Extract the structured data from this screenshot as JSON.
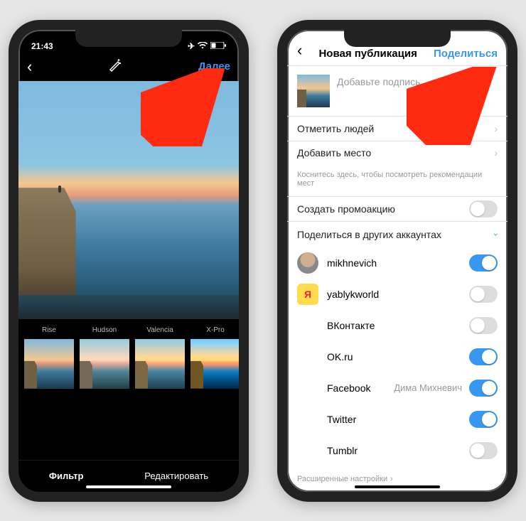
{
  "phone1": {
    "status": {
      "time": "21:43",
      "icons": [
        "airplane",
        "wifi",
        "battery"
      ]
    },
    "nav": {
      "next": "Далее"
    },
    "filters": [
      {
        "name": "Rise",
        "id": "rise"
      },
      {
        "name": "Hudson",
        "id": "hudson"
      },
      {
        "name": "Valencia",
        "id": "valencia"
      },
      {
        "name": "X-Pro",
        "id": "xpro"
      }
    ],
    "tabs": {
      "filter": "Фильтр",
      "edit": "Редактировать"
    }
  },
  "phone2": {
    "nav": {
      "title": "Новая публикация",
      "share": "Поделиться"
    },
    "caption_placeholder": "Добавьте подпись...",
    "rows": {
      "tag_people": "Отметить людей",
      "add_location": "Добавить место",
      "location_hint": "Коснитесь здесь, чтобы посмотреть рекомендации мест",
      "create_promo": "Создать промоакцию",
      "share_other": "Поделиться в других аккаунтах"
    },
    "accounts": [
      {
        "name": "mikhnevich",
        "avatar": "user",
        "on": true
      },
      {
        "name": "yablykworld",
        "avatar": "ya",
        "on": false
      }
    ],
    "networks": [
      {
        "name": "ВКонтакте",
        "sub": "",
        "on": false
      },
      {
        "name": "OK.ru",
        "sub": "",
        "on": true
      },
      {
        "name": "Facebook",
        "sub": "Дима Михневич",
        "on": true
      },
      {
        "name": "Twitter",
        "sub": "",
        "on": true
      },
      {
        "name": "Tumblr",
        "sub": "",
        "on": false
      }
    ],
    "advanced": "Расширенные настройки"
  },
  "style": {
    "accent": "#3897f0",
    "arrow": "#ff2a10"
  }
}
